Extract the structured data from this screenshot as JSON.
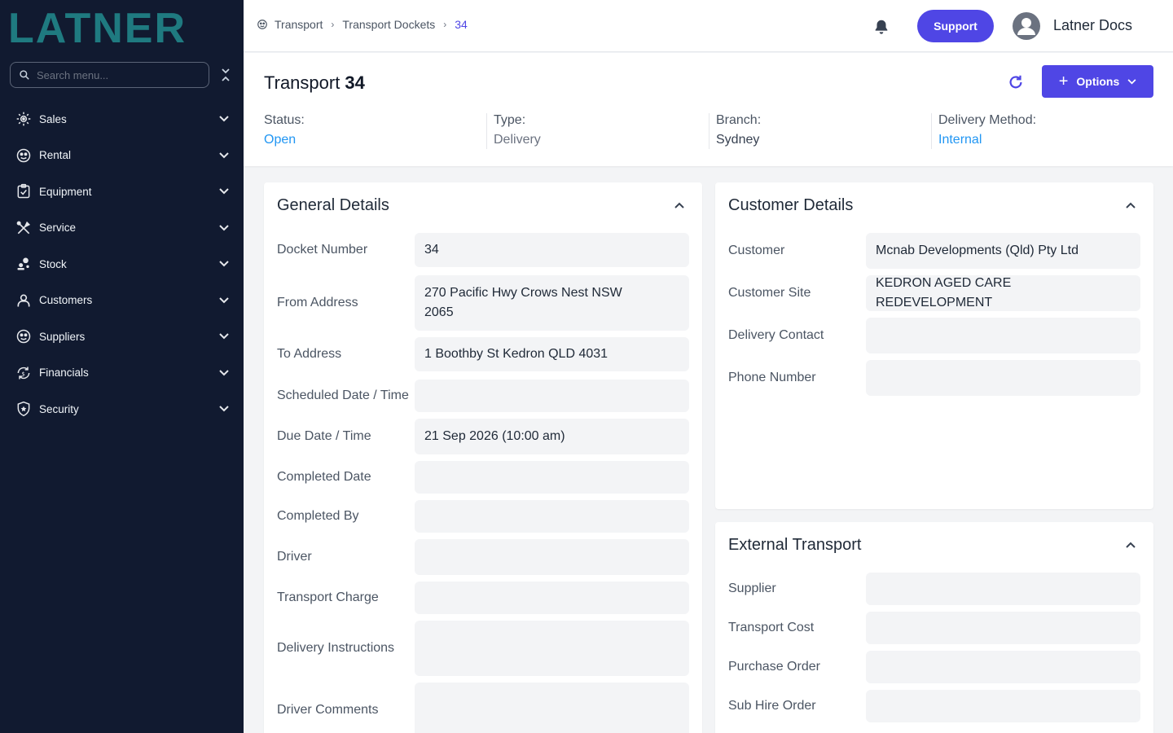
{
  "sidebar": {
    "logo_text": "LATNER",
    "search_placeholder": "Search menu...",
    "items": [
      {
        "label": "Sales",
        "icon": "sales-icon"
      },
      {
        "label": "Rental",
        "icon": "rental-icon"
      },
      {
        "label": "Equipment",
        "icon": "equipment-icon"
      },
      {
        "label": "Service",
        "icon": "service-icon"
      },
      {
        "label": "Stock",
        "icon": "stock-icon"
      },
      {
        "label": "Customers",
        "icon": "customers-icon"
      },
      {
        "label": "Suppliers",
        "icon": "suppliers-icon"
      },
      {
        "label": "Financials",
        "icon": "financials-icon"
      },
      {
        "label": "Security",
        "icon": "security-icon"
      }
    ]
  },
  "topbar": {
    "breadcrumb": [
      "Transport",
      "Transport Dockets",
      "34"
    ],
    "support_label": "Support",
    "user_name": "Latner Docs"
  },
  "header": {
    "title": "Transport",
    "number": "34",
    "options_label": "Options",
    "meta": [
      {
        "key": "Status:",
        "value": "Open"
      },
      {
        "key": "Type:",
        "value": "Delivery"
      },
      {
        "key": "Branch:",
        "value": "Sydney"
      },
      {
        "key": "Delivery Method:",
        "value": "Internal"
      }
    ]
  },
  "general": {
    "title": "General Details",
    "rows": [
      {
        "label": "Docket Number",
        "value": "34"
      },
      {
        "label": "From Address",
        "value": "270 Pacific Hwy Crows Nest NSW 2065"
      },
      {
        "label": "To Address",
        "value": "1 Boothby St Kedron QLD 4031"
      },
      {
        "label": "Scheduled Date / Time",
        "value": ""
      },
      {
        "label": "Due Date / Time",
        "value": "21 Sep 2026 (10:00 am)"
      },
      {
        "label": "Completed Date",
        "value": ""
      },
      {
        "label": "Completed By",
        "value": ""
      },
      {
        "label": "Driver",
        "value": ""
      },
      {
        "label": "Transport Charge",
        "value": ""
      },
      {
        "label": "Delivery Instructions",
        "value": ""
      },
      {
        "label": "Driver Comments",
        "value": ""
      }
    ]
  },
  "customer": {
    "title": "Customer Details",
    "rows": [
      {
        "label": "Customer",
        "value": "Mcnab Developments (Qld) Pty Ltd"
      },
      {
        "label": "Customer Site",
        "value": "KEDRON AGED CARE REDEVELOPMENT"
      },
      {
        "label": "Delivery Contact",
        "value": ""
      },
      {
        "label": "Phone Number",
        "value": ""
      }
    ]
  },
  "external": {
    "title": "External Transport",
    "rows": [
      {
        "label": "Supplier",
        "value": ""
      },
      {
        "label": "Transport Cost",
        "value": ""
      },
      {
        "label": "Purchase Order",
        "value": ""
      },
      {
        "label": "Sub Hire Order",
        "value": ""
      }
    ]
  },
  "colors": {
    "sidebar_bg": "#111a30",
    "accent": "#4f46e5",
    "link_blue": "#2196f3",
    "logo_teal": "#1f7a80"
  }
}
